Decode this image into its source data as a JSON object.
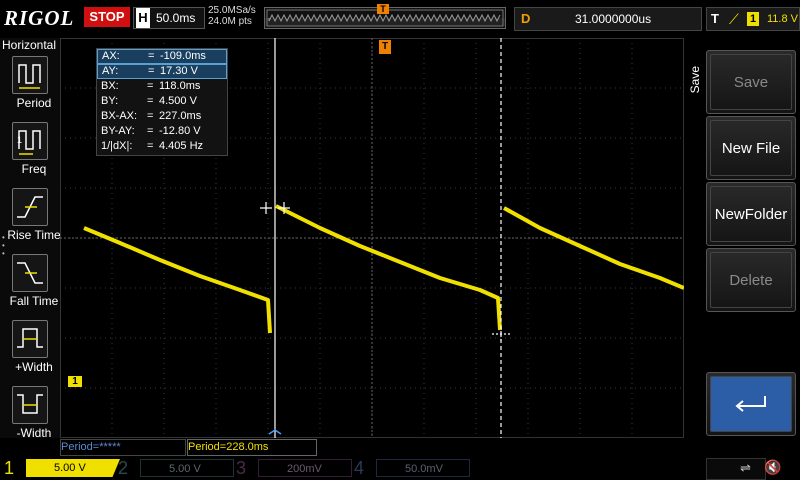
{
  "top_bar": {
    "brand": "RIGOL",
    "run_state": "STOP",
    "horizontal_label": "H",
    "timebase": "50.0ms",
    "sample_rate": "25.0MSa/s",
    "memory_depth": "24.0M pts",
    "trigger_pos_marker": "T",
    "delay_label": "D",
    "delay_value": "31.0000000us",
    "trigger_label": "T",
    "trigger_edge_icon": "rising-edge-icon",
    "trigger_source": "1",
    "trigger_level": "11.8 V"
  },
  "left_panel": {
    "title": "Horizontal",
    "items": [
      {
        "label": "Period",
        "icon": "period-icon"
      },
      {
        "label": "Freq",
        "icon": "frequency-icon"
      },
      {
        "label": "Rise Time",
        "icon": "rise-time-icon"
      },
      {
        "label": "Fall Time",
        "icon": "fall-time-icon"
      },
      {
        "label": "+Width",
        "icon": "positive-width-icon"
      },
      {
        "label": "-Width",
        "icon": "negative-width-icon"
      }
    ]
  },
  "cursor_readout": {
    "rows": [
      {
        "key": "AX:",
        "value": "-109.0ms"
      },
      {
        "key": "AY:",
        "value": "17.30 V"
      },
      {
        "key": "BX:",
        "value": "118.0ms"
      },
      {
        "key": "BY:",
        "value": "4.500 V"
      },
      {
        "key": "BX-AX:",
        "value": "227.0ms"
      },
      {
        "key": "BY-AY:",
        "value": "-12.80 V"
      },
      {
        "key": "1/|dX|:",
        "value": "4.405 Hz"
      }
    ]
  },
  "measurements": {
    "period1": "Period=*****",
    "period2": "Period=228.0ms"
  },
  "channels": [
    {
      "num": "1",
      "value": "5.00 V",
      "color": "#f0e000",
      "active": true
    },
    {
      "num": "2",
      "value": "5.00 V",
      "color": "#00c0c0",
      "active": false
    },
    {
      "num": "3",
      "value": "200mV",
      "color": "#d040d0",
      "active": false
    },
    {
      "num": "4",
      "value": "50.0mV",
      "color": "#2060e0",
      "active": false
    }
  ],
  "channel1_ground_marker": "1",
  "trigger_level_marker": "T",
  "right_menu": {
    "title": "Save",
    "buttons": [
      {
        "label": "Save",
        "enabled": false
      },
      {
        "label": "New File",
        "enabled": true
      },
      {
        "label": "NewFolder",
        "enabled": true
      },
      {
        "label": "Delete",
        "enabled": false
      }
    ],
    "back_icon": "return-arrow-icon"
  },
  "status_icons": [
    "usb-icon",
    "speaker-mute-icon"
  ],
  "colors": {
    "ch1": "#f0e000",
    "stop": "#d01010",
    "cursor_highlight": "#1a3f5e",
    "measure_link": "#5b8ad0"
  }
}
